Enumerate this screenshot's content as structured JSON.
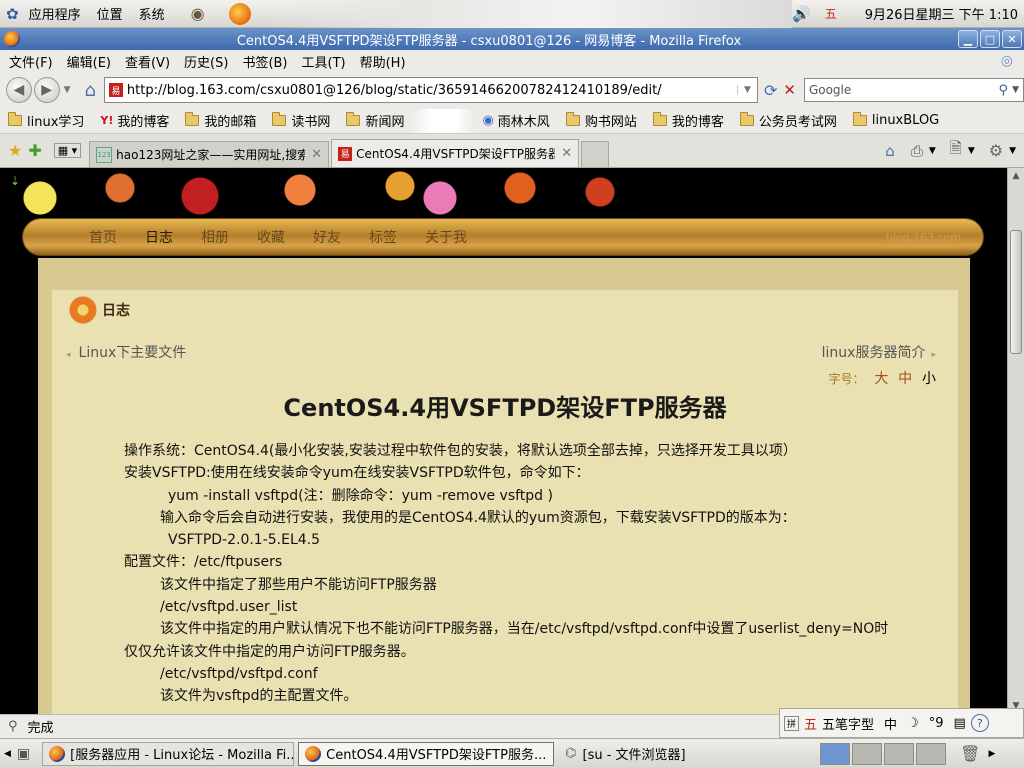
{
  "panel": {
    "menus": [
      "应用程序",
      "位置",
      "系统"
    ],
    "clock": "9月26日星期三 下午 1:10",
    "ime_indicator": "五"
  },
  "window": {
    "title": "CentOS4.4用VSFTPD架设FTP服务器 - csxu0801@126 - 网易博客 - Mozilla Firefox"
  },
  "menubar": [
    "文件(F)",
    "编辑(E)",
    "查看(V)",
    "历史(S)",
    "书签(B)",
    "工具(T)",
    "帮助(H)"
  ],
  "navbar": {
    "url": "http://blog.163.com/csxu0801@126/blog/static/3659146620078241241018​9/edit/",
    "search_placeholder": "Google"
  },
  "bookmarks": [
    "linux学习",
    "我的博客",
    "我的邮箱",
    "读书网",
    "新闻网",
    "",
    "雨林木风",
    "购书网站",
    "我的博客",
    "公务员考试网",
    "linuxBLOG"
  ],
  "tabs": [
    {
      "label": "hao123网址之家——实用网址,搜索...",
      "active": false
    },
    {
      "label": "CentOS4.4用VSFTPD架设FTP服务器...",
      "active": true
    }
  ],
  "blog": {
    "nav": [
      "首页",
      "日志",
      "相册",
      "收藏",
      "好友",
      "标签",
      "关于我"
    ],
    "brand": "blog.163.com",
    "section": "日志",
    "prev": "Linux下主要文件",
    "next": "linux服务器简介",
    "fontsize_label": "字号：",
    "fontsize_options": [
      "大",
      "中",
      "小"
    ],
    "title": "CentOS4.4用VSFTPD架设FTP服务器",
    "lines": [
      {
        "indent": 0,
        "text": "操作系统：CentOS4.4(最小化安装,安装过程中软件包的安装，将默认选项全部去掉，只选择开发工具以项）"
      },
      {
        "indent": 0,
        "text": "安装VSFTPD:使用在线安装命令yum在线安装VSFTPD软件包，命令如下："
      },
      {
        "indent": 2,
        "text": "yum -install vsftpd(注：删除命令：yum -remove vsftpd )"
      },
      {
        "indent": 1,
        "text": "输入命令后会自动进行安装，我使用的是CentOS4.4默认的yum资源包，下载安装VSFTPD的版本为："
      },
      {
        "indent": 2,
        "text": "VSFTPD-2.0.1-5.EL4.5"
      },
      {
        "indent": 0,
        "text": "配置文件：/etc/ftpusers"
      },
      {
        "indent": 1,
        "text": "该文件中指定了那些用户不能访问FTP服务器"
      },
      {
        "indent": 1,
        "text": "/etc/vsftpd.user_list"
      },
      {
        "indent": 1,
        "text": "该文件中指定的用户默认情况下也不能访问FTP服务器，当在/etc/vsftpd/vsftpd.conf中设置了userlist_deny=NO时"
      },
      {
        "indent": 0,
        "text": "仅仅允许该文件中指定的用户访问FTP服务器。"
      },
      {
        "indent": 1,
        "text": "/etc/vsftpd/vsftpd.conf"
      },
      {
        "indent": 1,
        "text": "该文件为vsftpd的主配置文件。"
      }
    ]
  },
  "status": {
    "text": "完成"
  },
  "ime": {
    "items": [
      "五",
      "五笔字型",
      "中",
      "☽",
      "°9"
    ]
  },
  "taskbar": [
    {
      "label": "[服务器应用 - Linux论坛 - Mozilla Fi...",
      "active": false
    },
    {
      "label": "CentOS4.4用VSFTPD架设FTP服务...",
      "active": true
    },
    {
      "label": "[su - 文件浏览器]",
      "active": false
    }
  ]
}
